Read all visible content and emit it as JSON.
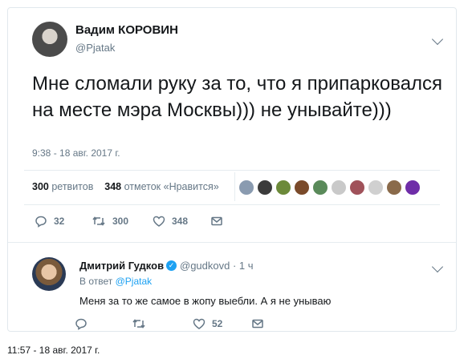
{
  "tweet": {
    "author_name": "Вадим КОРОВИН",
    "author_handle": "@Pjatak",
    "text": "Мне сломали руку за то, что я припарковался на месте мэра Москвы))) не унывайте)))",
    "timestamp": "9:38 - 18 авг. 2017 г.",
    "retweets_count": "300",
    "retweets_label": "ретвитов",
    "likes_count": "348",
    "likes_label": "отметок «Нравится»",
    "actions": {
      "reply_count": "32",
      "retweet_count": "300",
      "like_count": "348"
    },
    "liker_avatar_colors": [
      "#8a9bb0",
      "#3b3b3b",
      "#6c8a3a",
      "#7a4a2a",
      "#5a8a5a",
      "#c9c9c9",
      "#a0525a",
      "#d0d0d0",
      "#8a6a4a",
      "#6f2da8"
    ]
  },
  "reply": {
    "author_name": "Дмитрий Гудков",
    "author_handle": "@gudkovd · 1 ч",
    "in_reply_prefix": "В ответ",
    "in_reply_handle": "@Pjatak",
    "text": "Меня за то же самое в жопу выебли. А я не унываю",
    "actions": {
      "like_count": "52"
    }
  },
  "caption": "11:57 - 18 авг. 2017 г."
}
